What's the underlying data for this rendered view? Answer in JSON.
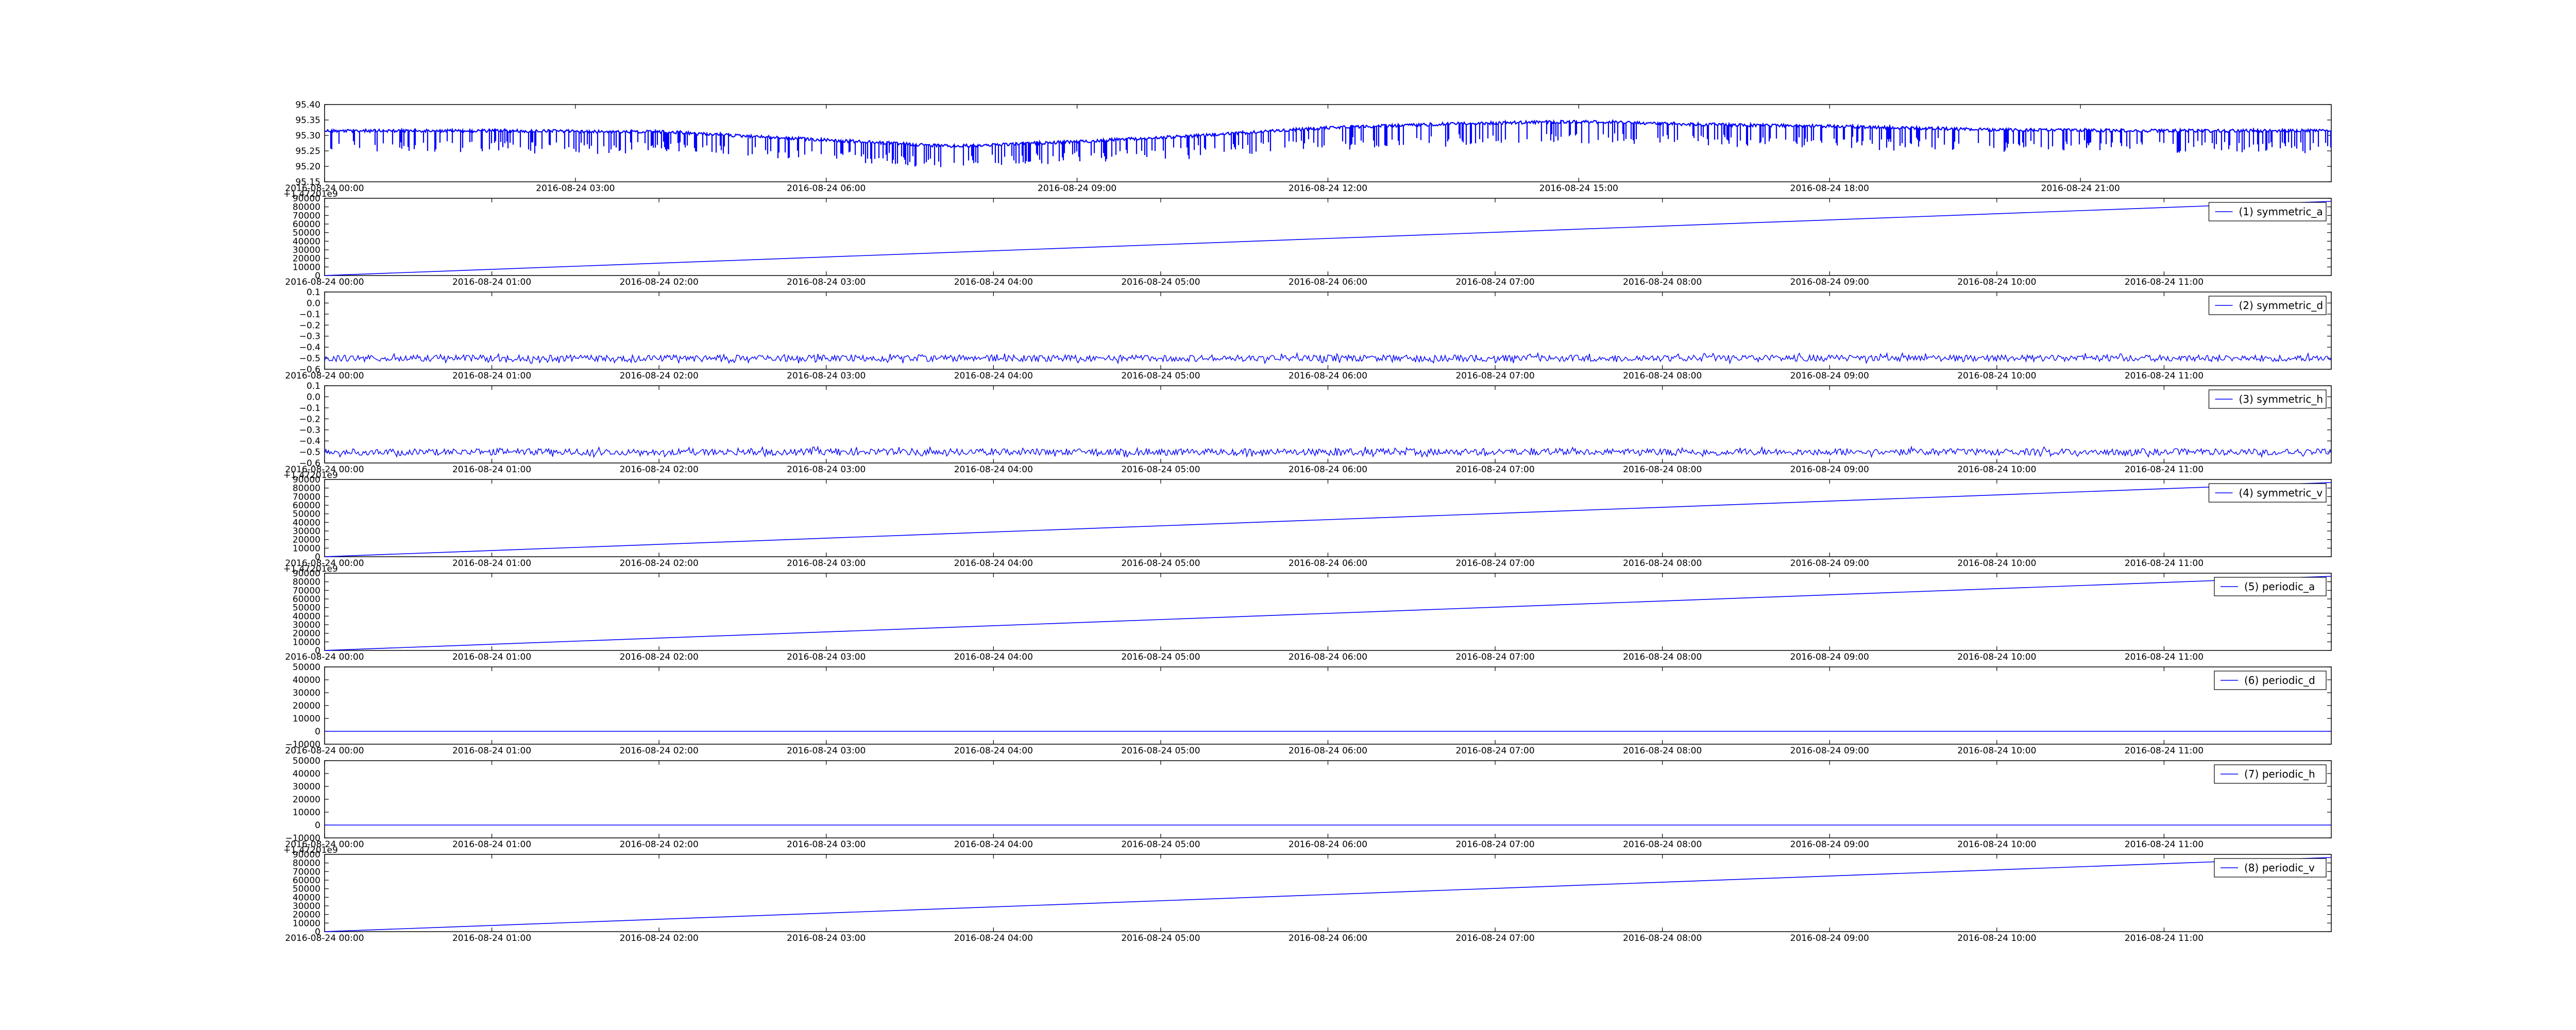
{
  "colors": {
    "series": "#0000ff",
    "axes": "#000000",
    "background": "#ffffff"
  },
  "chart_data": [
    {
      "type": "line",
      "title": "",
      "ylim": [
        95.15,
        95.4
      ],
      "xlim": [
        "2016-08-24 00:00",
        "2016-08-25 00:00"
      ],
      "y_ticks": [
        "95.15",
        "95.20",
        "95.25",
        "95.30",
        "95.35",
        "95.40"
      ],
      "x_ticks": [
        "2016-08-24 00:00",
        "2016-08-24 03:00",
        "2016-08-24 06:00",
        "2016-08-24 09:00",
        "2016-08-24 12:00",
        "2016-08-24 15:00",
        "2016-08-24 18:00",
        "2016-08-24 21:00"
      ],
      "offset_label": "",
      "legend": null,
      "legend_position": "none",
      "style": "noisy dense baseline with frequent downward spikes of about 0.07",
      "series": [
        {
          "x": [
            "2016-08-24 00:00",
            "2016-08-24 02:00",
            "2016-08-24 04:00",
            "2016-08-24 06:00",
            "2016-08-24 07:30",
            "2016-08-24 09:00",
            "2016-08-24 10:30",
            "2016-08-24 12:00",
            "2016-08-24 13:30",
            "2016-08-24 15:00",
            "2016-08-24 16:30",
            "2016-08-24 18:00",
            "2016-08-24 20:00",
            "2016-08-24 22:00",
            "2016-08-25 00:00"
          ],
          "y": [
            95.315,
            95.315,
            95.312,
            95.285,
            95.265,
            95.28,
            95.3,
            95.325,
            95.338,
            95.345,
            95.335,
            95.33,
            95.318,
            95.315,
            95.315
          ]
        }
      ]
    },
    {
      "type": "line",
      "ylim": [
        0,
        90000
      ],
      "xlim": [
        "2016-08-24 00:00",
        "2016-08-24 12:00"
      ],
      "y_ticks": [
        "0",
        "10000",
        "20000",
        "30000",
        "40000",
        "50000",
        "60000",
        "70000",
        "80000",
        "90000"
      ],
      "x_ticks": [
        "2016-08-24 00:00",
        "2016-08-24 01:00",
        "2016-08-24 02:00",
        "2016-08-24 03:00",
        "2016-08-24 04:00",
        "2016-08-24 05:00",
        "2016-08-24 06:00",
        "2016-08-24 07:00",
        "2016-08-24 08:00",
        "2016-08-24 09:00",
        "2016-08-24 10:00",
        "2016-08-24 11:00"
      ],
      "offset_label": "+1.47201e9",
      "legend": "(1) symmetric_a",
      "legend_position": "top-right",
      "style": "line",
      "series": [
        {
          "name": "(1) symmetric_a",
          "x": [
            "2016-08-24 00:00",
            "2016-08-24 12:00"
          ],
          "y": [
            0,
            86400
          ]
        }
      ]
    },
    {
      "type": "line",
      "ylim": [
        -0.6,
        0.1
      ],
      "xlim": [
        "2016-08-24 00:00",
        "2016-08-24 12:00"
      ],
      "y_ticks": [
        "−0.6",
        "−0.5",
        "−0.4",
        "−0.3",
        "−0.2",
        "−0.1",
        "0.0",
        "0.1"
      ],
      "x_ticks": [
        "2016-08-24 00:00",
        "2016-08-24 01:00",
        "2016-08-24 02:00",
        "2016-08-24 03:00",
        "2016-08-24 04:00",
        "2016-08-24 05:00",
        "2016-08-24 06:00",
        "2016-08-24 07:00",
        "2016-08-24 08:00",
        "2016-08-24 09:00",
        "2016-08-24 10:00",
        "2016-08-24 11:00"
      ],
      "offset_label": "",
      "legend": "(2) symmetric_d",
      "legend_position": "top-right",
      "style": "noise around -0.5 (range about -0.53 to -0.47)",
      "series": [
        {
          "name": "(2) symmetric_d",
          "x": [
            "2016-08-24 00:00",
            "2016-08-24 12:00"
          ],
          "y": [
            -0.5,
            -0.5
          ]
        }
      ]
    },
    {
      "type": "line",
      "ylim": [
        -0.6,
        0.1
      ],
      "xlim": [
        "2016-08-24 00:00",
        "2016-08-24 12:00"
      ],
      "y_ticks": [
        "−0.6",
        "−0.5",
        "−0.4",
        "−0.3",
        "−0.2",
        "−0.1",
        "0.0",
        "0.1"
      ],
      "x_ticks": [
        "2016-08-24 00:00",
        "2016-08-24 01:00",
        "2016-08-24 02:00",
        "2016-08-24 03:00",
        "2016-08-24 04:00",
        "2016-08-24 05:00",
        "2016-08-24 06:00",
        "2016-08-24 07:00",
        "2016-08-24 08:00",
        "2016-08-24 09:00",
        "2016-08-24 10:00",
        "2016-08-24 11:00"
      ],
      "offset_label": "",
      "legend": "(3) symmetric_h",
      "legend_position": "top-right",
      "style": "noise around -0.5 (range about -0.53 to -0.47)",
      "series": [
        {
          "name": "(3) symmetric_h",
          "x": [
            "2016-08-24 00:00",
            "2016-08-24 12:00"
          ],
          "y": [
            -0.5,
            -0.5
          ]
        }
      ]
    },
    {
      "type": "line",
      "ylim": [
        0,
        90000
      ],
      "xlim": [
        "2016-08-24 00:00",
        "2016-08-24 12:00"
      ],
      "y_ticks": [
        "0",
        "10000",
        "20000",
        "30000",
        "40000",
        "50000",
        "60000",
        "70000",
        "80000",
        "90000"
      ],
      "x_ticks": [
        "2016-08-24 00:00",
        "2016-08-24 01:00",
        "2016-08-24 02:00",
        "2016-08-24 03:00",
        "2016-08-24 04:00",
        "2016-08-24 05:00",
        "2016-08-24 06:00",
        "2016-08-24 07:00",
        "2016-08-24 08:00",
        "2016-08-24 09:00",
        "2016-08-24 10:00",
        "2016-08-24 11:00"
      ],
      "offset_label": "+1.47201e9",
      "legend": "(4) symmetric_v",
      "legend_position": "top-right",
      "style": "line",
      "series": [
        {
          "name": "(4) symmetric_v",
          "x": [
            "2016-08-24 00:00",
            "2016-08-24 12:00"
          ],
          "y": [
            0,
            86400
          ]
        }
      ]
    },
    {
      "type": "line",
      "ylim": [
        0,
        90000
      ],
      "xlim": [
        "2016-08-24 00:00",
        "2016-08-24 12:00"
      ],
      "y_ticks": [
        "0",
        "10000",
        "20000",
        "30000",
        "40000",
        "50000",
        "60000",
        "70000",
        "80000",
        "90000"
      ],
      "x_ticks": [
        "2016-08-24 00:00",
        "2016-08-24 01:00",
        "2016-08-24 02:00",
        "2016-08-24 03:00",
        "2016-08-24 04:00",
        "2016-08-24 05:00",
        "2016-08-24 06:00",
        "2016-08-24 07:00",
        "2016-08-24 08:00",
        "2016-08-24 09:00",
        "2016-08-24 10:00",
        "2016-08-24 11:00"
      ],
      "offset_label": "+1.47201e9",
      "legend": "(5) periodic_a",
      "legend_position": "top-right",
      "style": "line",
      "series": [
        {
          "name": "(5) periodic_a",
          "x": [
            "2016-08-24 00:00",
            "2016-08-24 12:00"
          ],
          "y": [
            0,
            86400
          ]
        }
      ]
    },
    {
      "type": "line",
      "ylim": [
        -10000,
        50000
      ],
      "xlim": [
        "2016-08-24 00:00",
        "2016-08-24 12:00"
      ],
      "y_ticks": [
        "−10000",
        "0",
        "10000",
        "20000",
        "30000",
        "40000",
        "50000"
      ],
      "x_ticks": [
        "2016-08-24 00:00",
        "2016-08-24 01:00",
        "2016-08-24 02:00",
        "2016-08-24 03:00",
        "2016-08-24 04:00",
        "2016-08-24 05:00",
        "2016-08-24 06:00",
        "2016-08-24 07:00",
        "2016-08-24 08:00",
        "2016-08-24 09:00",
        "2016-08-24 10:00",
        "2016-08-24 11:00"
      ],
      "offset_label": "",
      "legend": "(6) periodic_d",
      "legend_position": "top-right",
      "style": "line",
      "series": [
        {
          "name": "(6) periodic_d",
          "x": [
            "2016-08-24 00:00",
            "2016-08-24 12:00"
          ],
          "y": [
            0,
            0
          ]
        }
      ]
    },
    {
      "type": "line",
      "ylim": [
        -10000,
        50000
      ],
      "xlim": [
        "2016-08-24 00:00",
        "2016-08-24 12:00"
      ],
      "y_ticks": [
        "−10000",
        "0",
        "10000",
        "20000",
        "30000",
        "40000",
        "50000"
      ],
      "x_ticks": [
        "2016-08-24 00:00",
        "2016-08-24 01:00",
        "2016-08-24 02:00",
        "2016-08-24 03:00",
        "2016-08-24 04:00",
        "2016-08-24 05:00",
        "2016-08-24 06:00",
        "2016-08-24 07:00",
        "2016-08-24 08:00",
        "2016-08-24 09:00",
        "2016-08-24 10:00",
        "2016-08-24 11:00"
      ],
      "offset_label": "",
      "legend": "(7) periodic_h",
      "legend_position": "top-right",
      "style": "line",
      "series": [
        {
          "name": "(7) periodic_h",
          "x": [
            "2016-08-24 00:00",
            "2016-08-24 12:00"
          ],
          "y": [
            0,
            0
          ]
        }
      ]
    },
    {
      "type": "line",
      "ylim": [
        0,
        90000
      ],
      "xlim": [
        "2016-08-24 00:00",
        "2016-08-24 12:00"
      ],
      "y_ticks": [
        "0",
        "10000",
        "20000",
        "30000",
        "40000",
        "50000",
        "60000",
        "70000",
        "80000",
        "90000"
      ],
      "x_ticks": [
        "2016-08-24 00:00",
        "2016-08-24 01:00",
        "2016-08-24 02:00",
        "2016-08-24 03:00",
        "2016-08-24 04:00",
        "2016-08-24 05:00",
        "2016-08-24 06:00",
        "2016-08-24 07:00",
        "2016-08-24 08:00",
        "2016-08-24 09:00",
        "2016-08-24 10:00",
        "2016-08-24 11:00"
      ],
      "offset_label": "+1.47201e9",
      "legend": "(8) periodic_v",
      "legend_position": "top-right",
      "style": "line",
      "series": [
        {
          "name": "(8) periodic_v",
          "x": [
            "2016-08-24 00:00",
            "2016-08-24 12:00"
          ],
          "y": [
            0,
            86400
          ]
        }
      ]
    }
  ]
}
